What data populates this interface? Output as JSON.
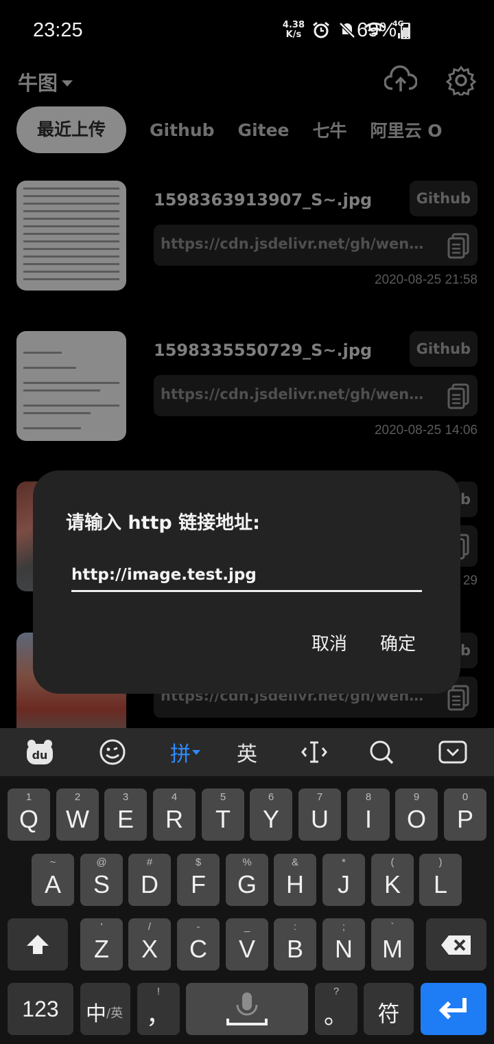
{
  "status_bar": {
    "time": "23:25",
    "net_speed_value": "4.38",
    "net_speed_unit": "K/s",
    "network_type": "4G",
    "battery": "69%"
  },
  "header": {
    "brand": "牛图",
    "upload_icon": "cloud-upload-icon",
    "settings_icon": "gear-icon"
  },
  "tabs": [
    "最近上传",
    "Github",
    "Gitee",
    "七牛",
    "阿里云 O"
  ],
  "items": [
    {
      "filename": "1598363913907_S~.jpg",
      "host": "Github",
      "url": "https://cdn.jsdelivr.net/gh/wenw...",
      "date": "2020-08-25 21:58"
    },
    {
      "filename": "1598335550729_S~.jpg",
      "host": "Github",
      "url": "https://cdn.jsdelivr.net/gh/wenw...",
      "date": "2020-08-25 14:06"
    },
    {
      "filename": "",
      "host": "b",
      "url": "",
      "date": "29"
    },
    {
      "filename": "",
      "host": "b",
      "url": "https://cdn.jsdelivr.net/gh/wenw...",
      "date": ""
    }
  ],
  "dialog": {
    "title": "请输入 http 链接地址:",
    "input_value": "http://image.test.jpg",
    "cancel_label": "取消",
    "ok_label": "确定"
  },
  "keyboard": {
    "toolbar": {
      "logo": "du",
      "pinyin": "拼",
      "english": "英"
    },
    "row1": [
      {
        "hint": "1",
        "ch": "Q"
      },
      {
        "hint": "2",
        "ch": "W"
      },
      {
        "hint": "3",
        "ch": "E"
      },
      {
        "hint": "4",
        "ch": "R"
      },
      {
        "hint": "5",
        "ch": "T"
      },
      {
        "hint": "6",
        "ch": "Y"
      },
      {
        "hint": "7",
        "ch": "U"
      },
      {
        "hint": "8",
        "ch": "I"
      },
      {
        "hint": "9",
        "ch": "O"
      },
      {
        "hint": "0",
        "ch": "P"
      }
    ],
    "row2": [
      {
        "hint": "~",
        "ch": "A"
      },
      {
        "hint": "@",
        "ch": "S"
      },
      {
        "hint": "#",
        "ch": "D"
      },
      {
        "hint": "$",
        "ch": "F"
      },
      {
        "hint": "%",
        "ch": "G"
      },
      {
        "hint": "&",
        "ch": "H"
      },
      {
        "hint": "*",
        "ch": "J"
      },
      {
        "hint": "(",
        "ch": "K"
      },
      {
        "hint": ")",
        "ch": "L"
      }
    ],
    "row3": [
      {
        "hint": "'",
        "ch": "Z"
      },
      {
        "hint": "/",
        "ch": "X"
      },
      {
        "hint": "-",
        "ch": "C"
      },
      {
        "hint": "_",
        "ch": "V"
      },
      {
        "hint": ":",
        "ch": "B"
      },
      {
        "hint": ";",
        "ch": "N"
      },
      {
        "hint": "`",
        "ch": "M"
      }
    ],
    "bottom": {
      "num": "123",
      "lang_main": "中",
      "lang_sub": "/英",
      "comma_hint": "!",
      "comma": "，",
      "period_hint": "?",
      "period": "。",
      "symbols": "符"
    }
  }
}
